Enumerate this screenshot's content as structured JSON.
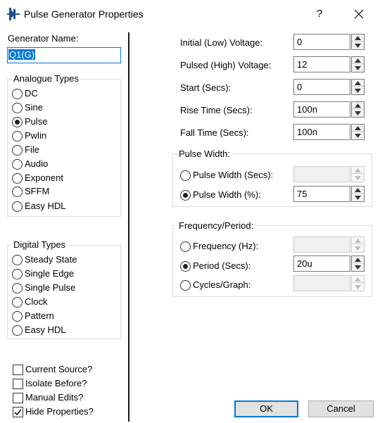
{
  "window": {
    "title": "Pulse Generator Properties",
    "help_label": "?"
  },
  "generator": {
    "name_label": "Generator Name:",
    "name_value": "Q1(G)"
  },
  "analogue": {
    "title": "Analogue Types",
    "options": [
      "DC",
      "Sine",
      "Pulse",
      "Pwlin",
      "File",
      "Audio",
      "Exponent",
      "SFFM",
      "Easy HDL"
    ],
    "selected": "Pulse"
  },
  "digital": {
    "title": "Digital Types",
    "options": [
      "Steady State",
      "Single Edge",
      "Single Pulse",
      "Clock",
      "Pattern",
      "Easy HDL"
    ]
  },
  "checkboxes": {
    "current_source": {
      "label": "Current Source?",
      "checked": false
    },
    "isolate_before": {
      "label": "Isolate Before?",
      "checked": false
    },
    "manual_edits": {
      "label": "Manual Edits?",
      "checked": false
    },
    "hide_properties": {
      "label": "Hide Properties?",
      "checked": true
    }
  },
  "params": {
    "initial_voltage": {
      "label": "Initial (Low) Voltage:",
      "value": "0"
    },
    "pulsed_voltage": {
      "label": "Pulsed (High) Voltage:",
      "value": "12"
    },
    "start": {
      "label": "Start (Secs):",
      "value": "0"
    },
    "rise_time": {
      "label": "Rise Time (Secs):",
      "value": "100n"
    },
    "fall_time": {
      "label": "Fall Time (Secs):",
      "value": "100n"
    }
  },
  "pulse_width": {
    "title": "Pulse Width:",
    "secs_label": "Pulse Width (Secs):",
    "secs_value": "",
    "pct_label": "Pulse Width (%):",
    "pct_value": "75",
    "selected": "percent"
  },
  "frequency": {
    "title": "Frequency/Period:",
    "freq_label": "Frequency (Hz):",
    "freq_value": "",
    "period_label": "Period (Secs):",
    "period_value": "20u",
    "cycles_label": "Cycles/Graph:",
    "cycles_value": "",
    "selected": "period"
  },
  "buttons": {
    "ok": "OK",
    "cancel": "Cancel"
  },
  "icons": {
    "app": "pulse-generator-icon",
    "close": "close-icon",
    "spin_up": "arrow-up-icon",
    "spin_down": "arrow-down-icon",
    "check": "checkmark-icon"
  }
}
